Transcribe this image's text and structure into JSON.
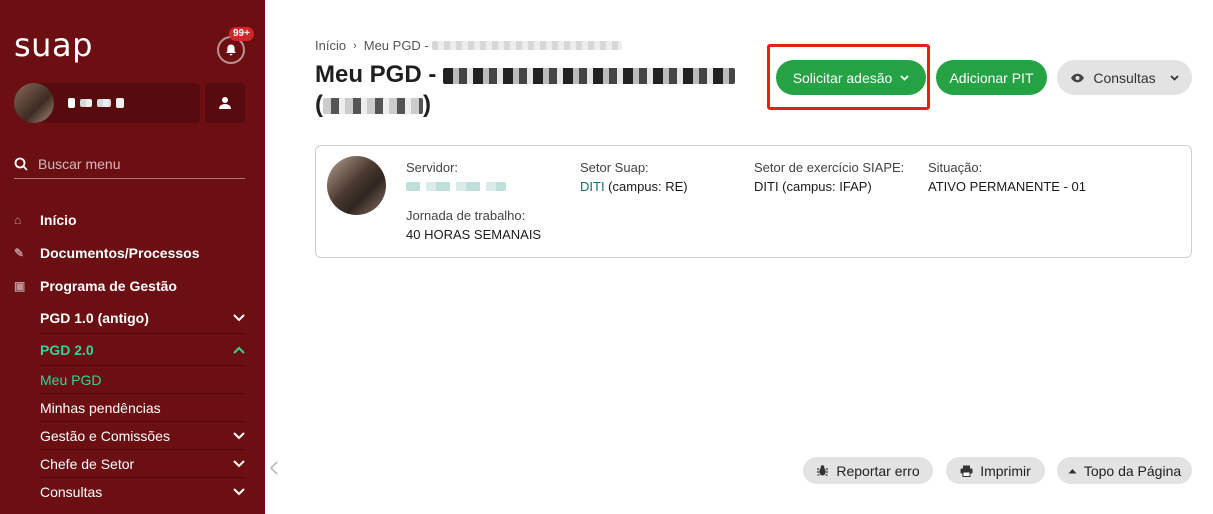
{
  "sidebar": {
    "logo": "suap",
    "notification_count": "99+",
    "search_placeholder": "Buscar menu",
    "menu": {
      "inicio": "Início",
      "documentos": "Documentos/Processos",
      "programa": "Programa de Gestão",
      "pgd1": "PGD 1.0 (antigo)",
      "pgd2": "PGD 2.0",
      "meu_pgd": "Meu PGD",
      "pendencias": "Minhas pendências",
      "gestao": "Gestão e Comissões",
      "chefe": "Chefe de Setor",
      "consultas": "Consultas"
    }
  },
  "breadcrumb": {
    "home": "Início",
    "current": "Meu PGD -"
  },
  "page": {
    "title_prefix": "Meu PGD -"
  },
  "actions": {
    "solicitar": "Solicitar adesão",
    "adicionar": "Adicionar PIT",
    "consultas": "Consultas"
  },
  "profile": {
    "servidor_label": "Servidor:",
    "setor_label": "Setor Suap:",
    "setor_value_link": "DITI",
    "setor_value_rest": " (campus: RE)",
    "exercicio_label": "Setor de exercício SIAPE:",
    "exercicio_value": "DITI (campus: IFAP)",
    "situacao_label": "Situação:",
    "situacao_value": "ATIVO PERMANENTE - 01",
    "jornada_label": "Jornada de trabalho:",
    "jornada_value": "40 HORAS SEMANAIS"
  },
  "footer": {
    "reportar": "Reportar erro",
    "imprimir": "Imprimir",
    "topo": "Topo da Página"
  },
  "colors": {
    "sidebar": "#6b0f12",
    "accent_green": "#25a244",
    "active_menu": "#34d399",
    "highlight": "#e32118"
  }
}
